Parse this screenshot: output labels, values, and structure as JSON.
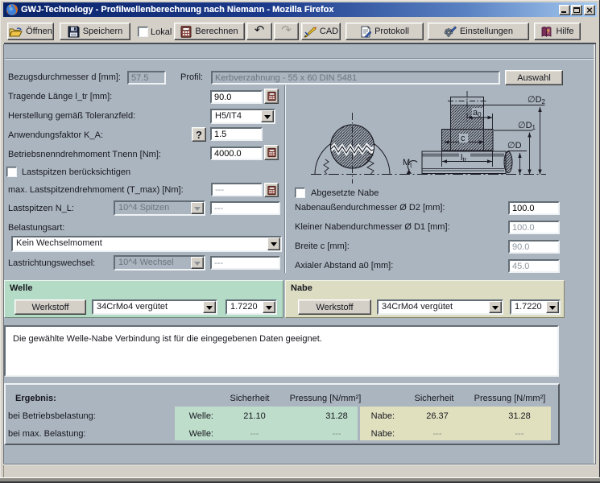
{
  "window": {
    "title": "GWJ-Technology - Profilwellenberechnung nach Niemann - Mozilla Firefox",
    "controls": {
      "minimize": "minimize",
      "maximize": "maximize",
      "close": "close"
    }
  },
  "toolbar": {
    "open": "Öffnen",
    "save": "Speichern",
    "local_checkbox": "Lokal",
    "calculate": "Berechnen",
    "cad": "CAD",
    "protocol": "Protokoll",
    "settings": "Einstellungen",
    "help": "Hilfe"
  },
  "form": {
    "bezugsdurchmesser": {
      "label": "Bezugsdurchmesser d [mm]:",
      "value": "57.5"
    },
    "profil": {
      "label": "Profil:",
      "value": "Kerbverzahnung - 55 x 60 DIN 5481",
      "button": "Auswahl"
    },
    "tragende_laenge": {
      "label": "Tragende Länge l_tr [mm]:",
      "value": "90.0"
    },
    "toleranzfeld": {
      "label": "Herstellung gemäß Toleranzfeld:",
      "value": "H5/IT4"
    },
    "anwendungsfaktor": {
      "label": "Anwendungsfaktor K_A:",
      "help_button": "?",
      "value": "1.5"
    },
    "drehmoment": {
      "label": "Betriebsnenndrehmoment Tnenn [Nm]:",
      "value": "4000.0"
    },
    "lastspitzen_checkbox": "Lastspitzen berücksichtigen",
    "max_lastspitze": {
      "label": "max. Lastspitzendrehmoment (T_max) [Nm]:",
      "value": "---"
    },
    "lastspitzen_nl": {
      "label": "Lastspitzen N_L:",
      "value": "10^4 Spitzen",
      "value2": "---"
    },
    "belastungsart": {
      "label": "Belastungsart:",
      "value": "Kein Wechselmoment"
    },
    "lastrichtungswechsel": {
      "label": "Lastrichtungswechsel:",
      "value": "10^4 Wechsel",
      "value2": "---"
    }
  },
  "nabe_form": {
    "abgesetzte_checkbox": "Abgesetzte Nabe",
    "d2": {
      "label": "Nabenaußendurchmesser Ø D2 [mm]:",
      "value": "100.0"
    },
    "d1": {
      "label": "Kleiner Nabendurchmesser Ø D1 [mm]:",
      "value": "100.0"
    },
    "breite": {
      "label": "Breite c [mm]:",
      "value": "90.0"
    },
    "abstand": {
      "label": "Axialer Abstand a0 [mm]:",
      "value": "45.0"
    }
  },
  "drawing": {
    "mt": "M",
    "mt_sub": "t",
    "ltr": "l",
    "ltr_sub": "tr",
    "c": "c",
    "a0": "a",
    "a0_sub": "0",
    "dd": "∅D",
    "dd1": "∅D",
    "dd1_sub": "1",
    "dd2": "∅D",
    "dd2_sub": "2"
  },
  "welle": {
    "title": "Welle",
    "werkstoff_button": "Werkstoff",
    "material": "34CrMo4 vergütet",
    "number": "1.7220"
  },
  "nabe": {
    "title": "Nabe",
    "werkstoff_button": "Werkstoff",
    "material": "34CrMo4 vergütet",
    "number": "1.7220"
  },
  "message": "Die gewählte Welle-Nabe Verbindung ist für die eingegebenen Daten geeignet.",
  "results": {
    "title": "Ergebnis:",
    "col_sicherheit": "Sicherheit",
    "col_pressung": "Pressung [N/mm²]",
    "rows": [
      {
        "label": "bei Betriebsbelastung:",
        "welle_label": "Welle:",
        "welle_sicherheit": "21.10",
        "welle_pressung": "31.28",
        "nabe_label": "Nabe:",
        "nabe_sicherheit": "26.37",
        "nabe_pressung": "31.28"
      },
      {
        "label": "bei max. Belastung:",
        "welle_label": "Welle:",
        "welle_sicherheit": "---",
        "welle_pressung": "---",
        "nabe_label": "Nabe:",
        "nabe_sicherheit": "---",
        "nabe_pressung": "---"
      }
    ]
  },
  "colors": {
    "titlebar_left": "#0a246a",
    "titlebar_right": "#a6caf0",
    "chrome": "#d4d0c8",
    "content_bg": "#abb5bf",
    "welle_green": "#b4dbc6",
    "nabe_tan": "#dcdcc2",
    "result_green": "#bedecb",
    "result_tan": "#e0e0bf"
  }
}
